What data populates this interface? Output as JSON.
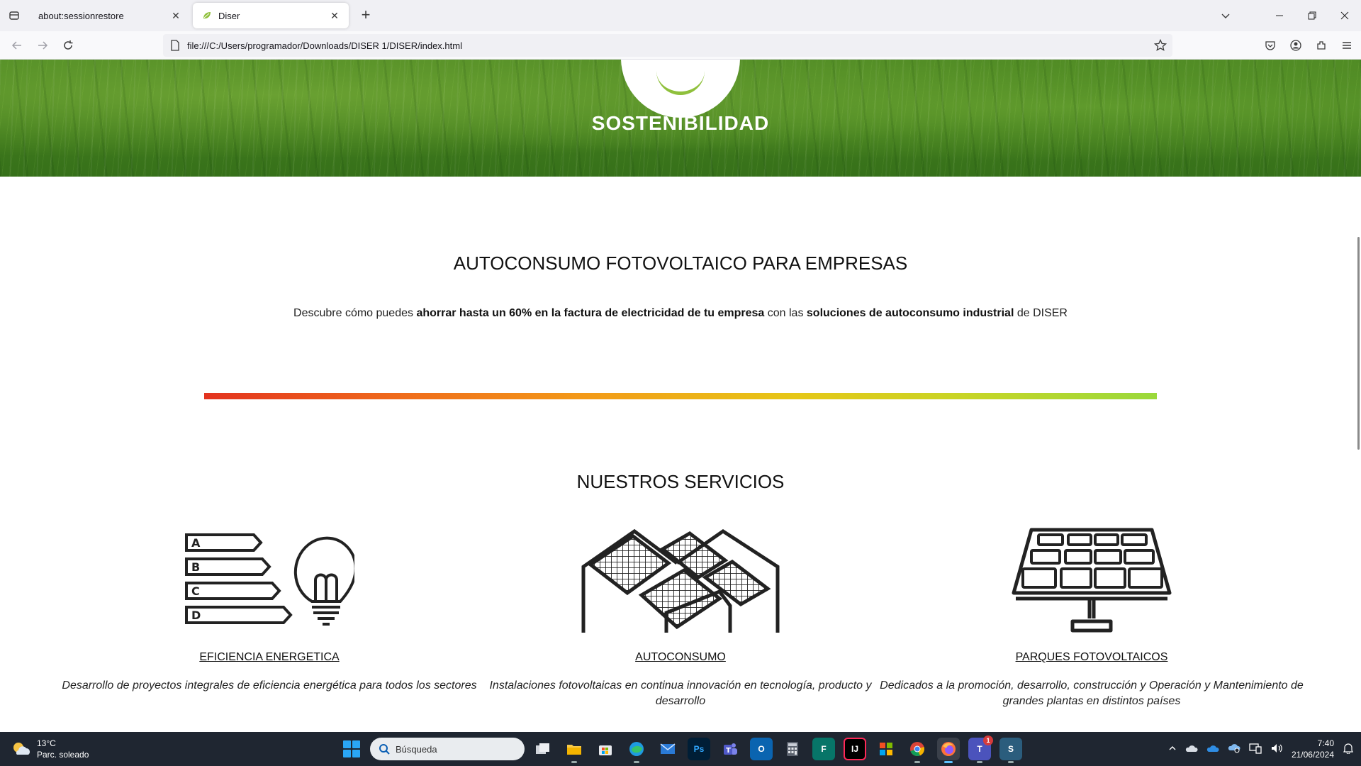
{
  "browser": {
    "tabs": [
      {
        "title": "about:sessionrestore",
        "active": false
      },
      {
        "title": "Diser",
        "active": true
      }
    ],
    "url": "file:///C:/Users/programador/Downloads/DISER 1/DISER/index.html"
  },
  "hero": {
    "title": "SOSTENIBILIDAD"
  },
  "intro_section": {
    "title": "AUTOCONSUMO FOTOVOLTAICO PARA EMPRESAS",
    "text_1": "Descubre cómo puedes ",
    "bold_1": "ahorrar hasta un 60% en la factura de electricidad de tu empresa",
    "text_2": " con las ",
    "bold_2": "soluciones de autoconsumo industrial",
    "text_3": " de DISER"
  },
  "services": {
    "title": "NUESTROS SERVICIOS",
    "items": [
      {
        "name": "EFICIENCIA ENERGETICA",
        "description": "Desarrollo de proyectos integrales de eficiencia energética para todos los sectores",
        "icon": "energy-efficiency-icon",
        "labels": [
          "A",
          "B",
          "C",
          "D"
        ]
      },
      {
        "name": "AUTOCONSUMO",
        "description": "Instalaciones fotovoltaicas en continua innovación en tecnología, producto y desarrollo",
        "icon": "rooftop-solar-icon"
      },
      {
        "name": "PARQUES FOTOVOLTAICOS",
        "description": "Dedicados a la promoción, desarrollo, construcción y Operación y Mantenimiento de grandes plantas en distintos países",
        "icon": "solar-panel-icon"
      }
    ]
  },
  "colors": {
    "hero_green": "#4f8a24",
    "bar_start": "#e3331f",
    "bar_end": "#9ad93b",
    "taskbar": "#1f2631"
  },
  "taskbar": {
    "weather_temp": "13°C",
    "weather_desc": "Parc. soleado",
    "search_placeholder": "Búsqueda",
    "apps": [
      {
        "name": "task-view",
        "glyph": ""
      },
      {
        "name": "file-explorer",
        "glyph": ""
      },
      {
        "name": "store",
        "glyph": ""
      },
      {
        "name": "edge",
        "glyph": ""
      },
      {
        "name": "mail",
        "glyph": ""
      },
      {
        "name": "photoshop",
        "glyph": "Ps"
      },
      {
        "name": "teams",
        "glyph": ""
      },
      {
        "name": "outlook",
        "glyph": "O"
      },
      {
        "name": "calculator",
        "glyph": ""
      },
      {
        "name": "forms",
        "glyph": "F"
      },
      {
        "name": "jetbrains",
        "glyph": "IJ"
      },
      {
        "name": "microsoft",
        "glyph": ""
      },
      {
        "name": "chrome",
        "glyph": ""
      },
      {
        "name": "firefox",
        "glyph": ""
      },
      {
        "name": "teams-new",
        "glyph": "T",
        "badge": "1"
      },
      {
        "name": "notepad",
        "glyph": "S"
      }
    ],
    "time": "7:40",
    "date": "21/06/2024"
  }
}
